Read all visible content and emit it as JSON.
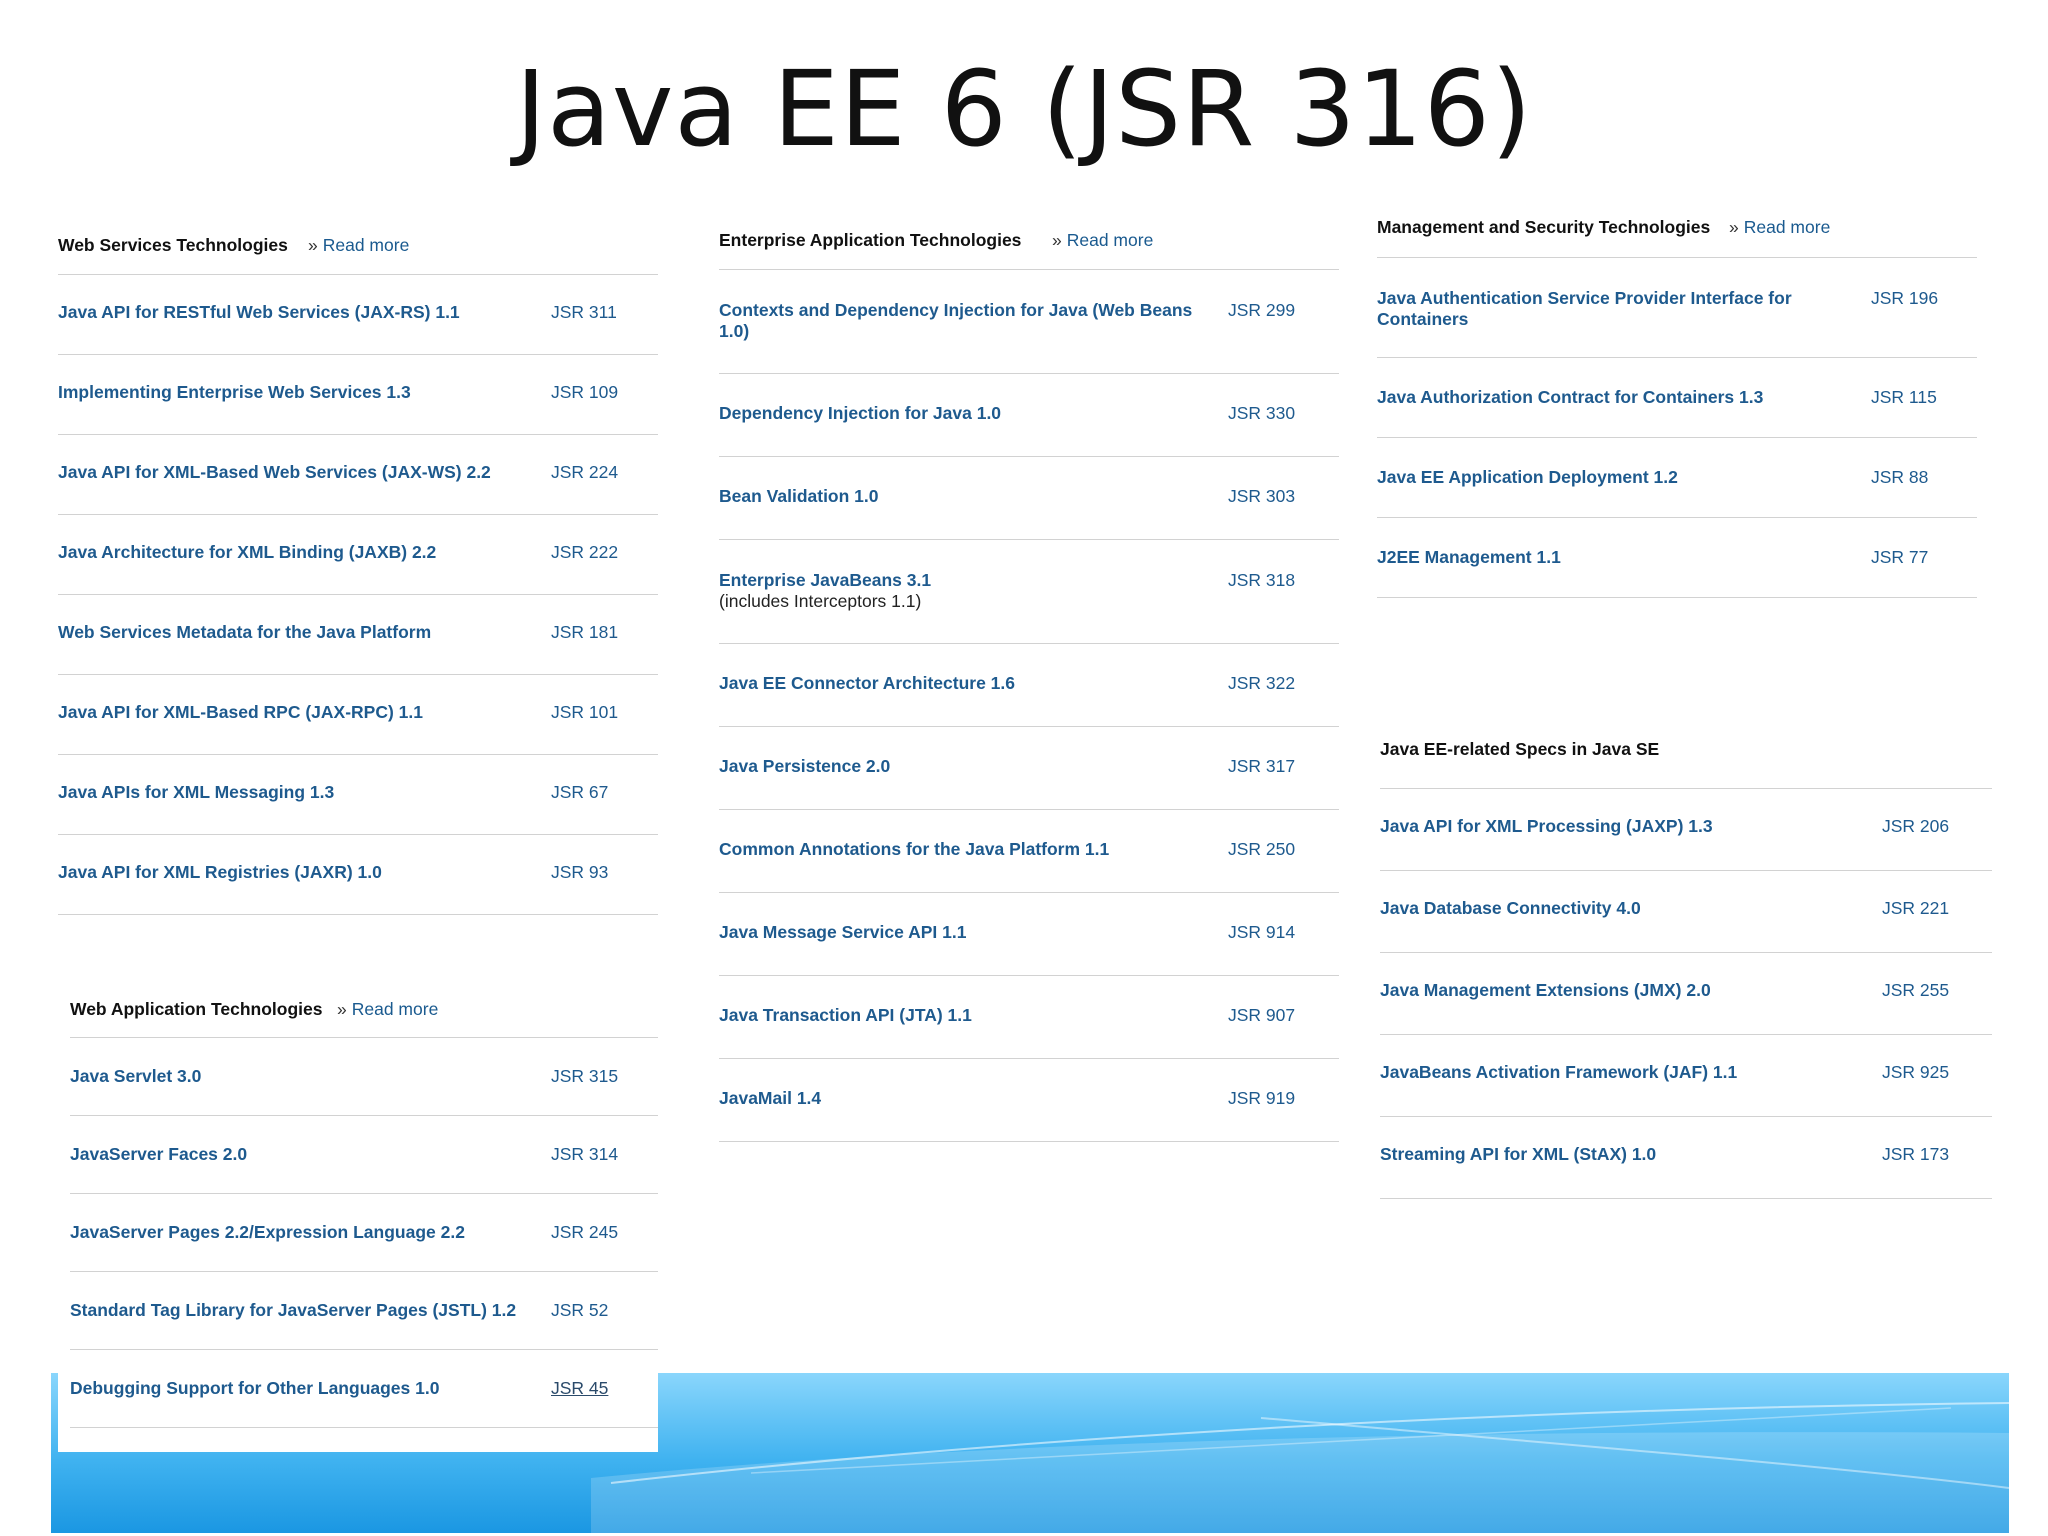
{
  "slide_title": "Java EE 6 (JSR 316)",
  "read_more_label": "Read more",
  "colors": {
    "title": "#111111",
    "link": "#1e5a8e",
    "divider": "#d2d2d2",
    "wave_light": "#7fd0fb",
    "wave_dark": "#1f9de6"
  },
  "web_services": {
    "title": "Web Services Technologies",
    "items": [
      {
        "name": "Java API for RESTful Web Services (JAX-RS) 1.1",
        "jsr": "JSR 311"
      },
      {
        "name": "Implementing Enterprise Web Services 1.3",
        "jsr": "JSR 109"
      },
      {
        "name": "Java API for XML-Based Web Services (JAX-WS) 2.2",
        "jsr": "JSR 224"
      },
      {
        "name": "Java Architecture for XML Binding (JAXB) 2.2",
        "jsr": "JSR 222"
      },
      {
        "name": "Web Services Metadata for the Java Platform",
        "jsr": "JSR 181"
      },
      {
        "name": "Java API for XML-Based RPC (JAX-RPC) 1.1",
        "jsr": "JSR 101"
      },
      {
        "name": "Java APIs for XML Messaging 1.3",
        "jsr": "JSR 67"
      },
      {
        "name": "Java API for XML Registries (JAXR) 1.0",
        "jsr": "JSR 93"
      }
    ]
  },
  "web_app": {
    "title": "Web Application Technologies",
    "items": [
      {
        "name": "Java Servlet 3.0",
        "jsr": "JSR 315"
      },
      {
        "name": "JavaServer Faces 2.0",
        "jsr": "JSR 314"
      },
      {
        "name": "JavaServer Pages 2.2/Expression Language 2.2",
        "jsr": "JSR 245"
      },
      {
        "name": "Standard Tag Library for JavaServer Pages (JSTL) 1.2",
        "jsr": "JSR 52"
      },
      {
        "name": "Debugging Support for Other Languages 1.0",
        "jsr": "JSR 45"
      }
    ]
  },
  "enterprise": {
    "title": "Enterprise Application Technologies",
    "items": [
      {
        "name": "Contexts and Dependency Injection for Java (Web Beans 1.0)",
        "jsr": "JSR 299"
      },
      {
        "name": "Dependency Injection for Java 1.0",
        "jsr": "JSR 330"
      },
      {
        "name": "Bean Validation 1.0",
        "jsr": "JSR 303"
      },
      {
        "name": "Enterprise JavaBeans 3.1",
        "sub": "(includes Interceptors 1.1)",
        "jsr": "JSR 318"
      },
      {
        "name": "Java EE Connector Architecture 1.6",
        "jsr": "JSR 322"
      },
      {
        "name": "Java Persistence 2.0",
        "jsr": "JSR 317"
      },
      {
        "name": "Common Annotations for the Java Platform 1.1",
        "jsr": "JSR 250"
      },
      {
        "name": "Java Message Service API 1.1",
        "jsr": "JSR 914"
      },
      {
        "name": "Java Transaction API (JTA) 1.1",
        "jsr": "JSR 907"
      },
      {
        "name": "JavaMail 1.4",
        "jsr": "JSR 919"
      }
    ]
  },
  "mgmt_security": {
    "title": "Management and Security Technologies",
    "items": [
      {
        "name": "Java Authentication Service Provider Interface for Containers",
        "jsr": "JSR 196"
      },
      {
        "name": "Java Authorization Contract for Containers 1.3",
        "jsr": "JSR 115"
      },
      {
        "name": "Java EE Application Deployment 1.2",
        "jsr": "JSR 88"
      },
      {
        "name": "J2EE Management 1.1",
        "jsr": "JSR 77"
      }
    ]
  },
  "java_se": {
    "title": "Java EE-related Specs in Java SE",
    "items": [
      {
        "name": "Java API for XML Processing (JAXP) 1.3",
        "jsr": "JSR 206"
      },
      {
        "name": "Java Database Connectivity 4.0",
        "jsr": "JSR 221"
      },
      {
        "name": "Java Management Extensions (JMX) 2.0",
        "jsr": "JSR 255"
      },
      {
        "name": "JavaBeans Activation Framework (JAF) 1.1",
        "jsr": "JSR 925"
      },
      {
        "name": "Streaming API for XML (StAX) 1.0",
        "jsr": "JSR 173"
      }
    ]
  }
}
